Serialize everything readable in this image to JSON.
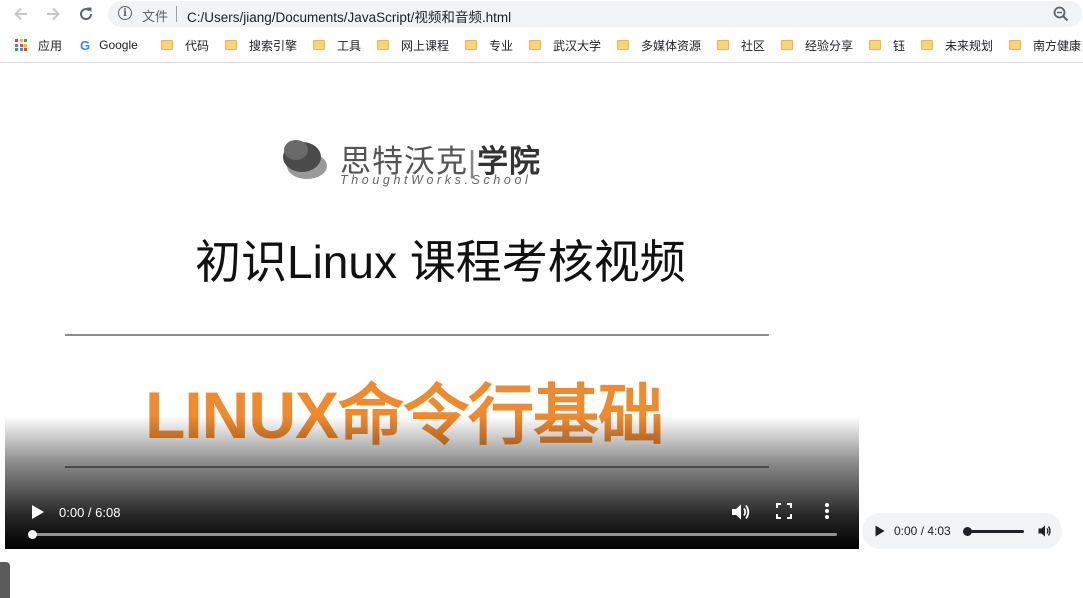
{
  "browser": {
    "omnibox": {
      "scheme_label": "文件",
      "url": "C:/Users/jiang/Documents/JavaScript/视频和音频.html"
    },
    "bookmarks": [
      {
        "label": "应用",
        "icon": "apps-grid-icon"
      },
      {
        "label": "Google",
        "icon": "google-icon"
      },
      {
        "label": "代码",
        "icon": "folder-icon"
      },
      {
        "label": "搜索引擎",
        "icon": "folder-icon"
      },
      {
        "label": "工具",
        "icon": "folder-icon"
      },
      {
        "label": "网上课程",
        "icon": "folder-icon"
      },
      {
        "label": "专业",
        "icon": "folder-icon"
      },
      {
        "label": "武汉大学",
        "icon": "folder-icon"
      },
      {
        "label": "多媒体资源",
        "icon": "folder-icon"
      },
      {
        "label": "社区",
        "icon": "folder-icon"
      },
      {
        "label": "经验分享",
        "icon": "folder-icon"
      },
      {
        "label": "钰",
        "icon": "folder-icon"
      },
      {
        "label": "未来规划",
        "icon": "folder-icon"
      },
      {
        "label": "南方健康",
        "icon": "folder-icon"
      }
    ]
  },
  "video": {
    "logo_cn_name": "思特沃克",
    "logo_sep": "|",
    "logo_cn_school": "学院",
    "logo_en": "ThoughtWorks.School",
    "title": "初识Linux 课程考核视频",
    "subtitle": "LINUX命令行基础",
    "time": "0:00 / 6:08",
    "progress": 0
  },
  "audio": {
    "time": "0:00 / 4:03",
    "progress": 0
  },
  "colors": {
    "accent_orange": "#ef8a2e",
    "omnibox_bg": "#f1f3f4",
    "folder": "#f7d37c"
  }
}
